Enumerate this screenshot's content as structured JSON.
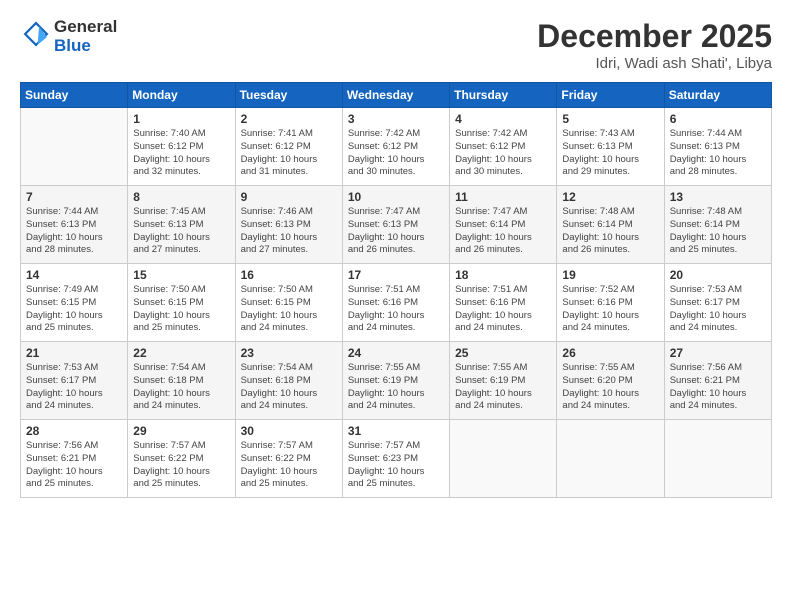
{
  "header": {
    "logo_line1": "General",
    "logo_line2": "Blue",
    "month": "December 2025",
    "location": "Idri, Wadi ash Shati', Libya"
  },
  "weekdays": [
    "Sunday",
    "Monday",
    "Tuesday",
    "Wednesday",
    "Thursday",
    "Friday",
    "Saturday"
  ],
  "weeks": [
    [
      {
        "day": "",
        "info": ""
      },
      {
        "day": "1",
        "info": "Sunrise: 7:40 AM\nSunset: 6:12 PM\nDaylight: 10 hours\nand 32 minutes."
      },
      {
        "day": "2",
        "info": "Sunrise: 7:41 AM\nSunset: 6:12 PM\nDaylight: 10 hours\nand 31 minutes."
      },
      {
        "day": "3",
        "info": "Sunrise: 7:42 AM\nSunset: 6:12 PM\nDaylight: 10 hours\nand 30 minutes."
      },
      {
        "day": "4",
        "info": "Sunrise: 7:42 AM\nSunset: 6:12 PM\nDaylight: 10 hours\nand 30 minutes."
      },
      {
        "day": "5",
        "info": "Sunrise: 7:43 AM\nSunset: 6:13 PM\nDaylight: 10 hours\nand 29 minutes."
      },
      {
        "day": "6",
        "info": "Sunrise: 7:44 AM\nSunset: 6:13 PM\nDaylight: 10 hours\nand 28 minutes."
      }
    ],
    [
      {
        "day": "7",
        "info": "Sunrise: 7:44 AM\nSunset: 6:13 PM\nDaylight: 10 hours\nand 28 minutes."
      },
      {
        "day": "8",
        "info": "Sunrise: 7:45 AM\nSunset: 6:13 PM\nDaylight: 10 hours\nand 27 minutes."
      },
      {
        "day": "9",
        "info": "Sunrise: 7:46 AM\nSunset: 6:13 PM\nDaylight: 10 hours\nand 27 minutes."
      },
      {
        "day": "10",
        "info": "Sunrise: 7:47 AM\nSunset: 6:13 PM\nDaylight: 10 hours\nand 26 minutes."
      },
      {
        "day": "11",
        "info": "Sunrise: 7:47 AM\nSunset: 6:14 PM\nDaylight: 10 hours\nand 26 minutes."
      },
      {
        "day": "12",
        "info": "Sunrise: 7:48 AM\nSunset: 6:14 PM\nDaylight: 10 hours\nand 26 minutes."
      },
      {
        "day": "13",
        "info": "Sunrise: 7:48 AM\nSunset: 6:14 PM\nDaylight: 10 hours\nand 25 minutes."
      }
    ],
    [
      {
        "day": "14",
        "info": "Sunrise: 7:49 AM\nSunset: 6:15 PM\nDaylight: 10 hours\nand 25 minutes."
      },
      {
        "day": "15",
        "info": "Sunrise: 7:50 AM\nSunset: 6:15 PM\nDaylight: 10 hours\nand 25 minutes."
      },
      {
        "day": "16",
        "info": "Sunrise: 7:50 AM\nSunset: 6:15 PM\nDaylight: 10 hours\nand 24 minutes."
      },
      {
        "day": "17",
        "info": "Sunrise: 7:51 AM\nSunset: 6:16 PM\nDaylight: 10 hours\nand 24 minutes."
      },
      {
        "day": "18",
        "info": "Sunrise: 7:51 AM\nSunset: 6:16 PM\nDaylight: 10 hours\nand 24 minutes."
      },
      {
        "day": "19",
        "info": "Sunrise: 7:52 AM\nSunset: 6:16 PM\nDaylight: 10 hours\nand 24 minutes."
      },
      {
        "day": "20",
        "info": "Sunrise: 7:53 AM\nSunset: 6:17 PM\nDaylight: 10 hours\nand 24 minutes."
      }
    ],
    [
      {
        "day": "21",
        "info": "Sunrise: 7:53 AM\nSunset: 6:17 PM\nDaylight: 10 hours\nand 24 minutes."
      },
      {
        "day": "22",
        "info": "Sunrise: 7:54 AM\nSunset: 6:18 PM\nDaylight: 10 hours\nand 24 minutes."
      },
      {
        "day": "23",
        "info": "Sunrise: 7:54 AM\nSunset: 6:18 PM\nDaylight: 10 hours\nand 24 minutes."
      },
      {
        "day": "24",
        "info": "Sunrise: 7:55 AM\nSunset: 6:19 PM\nDaylight: 10 hours\nand 24 minutes."
      },
      {
        "day": "25",
        "info": "Sunrise: 7:55 AM\nSunset: 6:19 PM\nDaylight: 10 hours\nand 24 minutes."
      },
      {
        "day": "26",
        "info": "Sunrise: 7:55 AM\nSunset: 6:20 PM\nDaylight: 10 hours\nand 24 minutes."
      },
      {
        "day": "27",
        "info": "Sunrise: 7:56 AM\nSunset: 6:21 PM\nDaylight: 10 hours\nand 24 minutes."
      }
    ],
    [
      {
        "day": "28",
        "info": "Sunrise: 7:56 AM\nSunset: 6:21 PM\nDaylight: 10 hours\nand 25 minutes."
      },
      {
        "day": "29",
        "info": "Sunrise: 7:57 AM\nSunset: 6:22 PM\nDaylight: 10 hours\nand 25 minutes."
      },
      {
        "day": "30",
        "info": "Sunrise: 7:57 AM\nSunset: 6:22 PM\nDaylight: 10 hours\nand 25 minutes."
      },
      {
        "day": "31",
        "info": "Sunrise: 7:57 AM\nSunset: 6:23 PM\nDaylight: 10 hours\nand 25 minutes."
      },
      {
        "day": "",
        "info": ""
      },
      {
        "day": "",
        "info": ""
      },
      {
        "day": "",
        "info": ""
      }
    ]
  ]
}
